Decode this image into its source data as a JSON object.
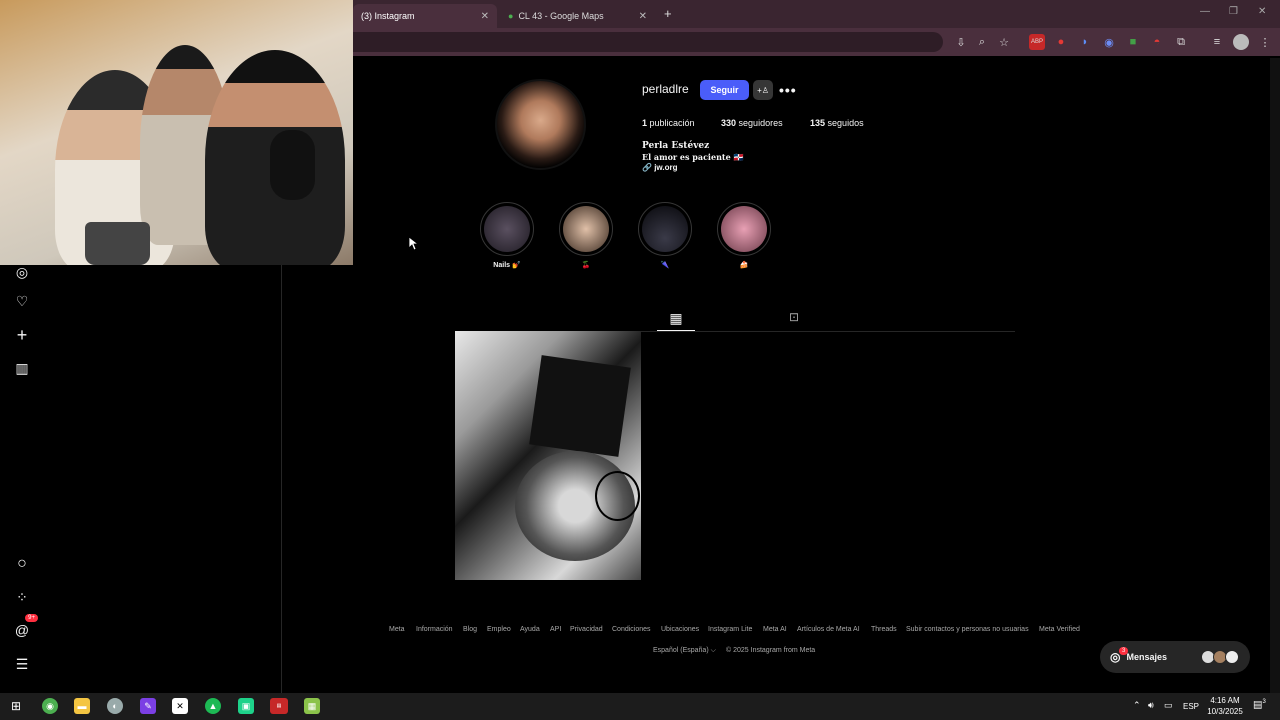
{
  "browser": {
    "tabs": [
      {
        "title": "(3) Instagram",
        "active": true
      },
      {
        "title": "CL 43 - Google Maps",
        "active": false
      }
    ],
    "new_tab_label": "+"
  },
  "profile": {
    "username": "perladlre",
    "follow_label": "Seguir",
    "stats": [
      {
        "count": "1",
        "label": "publicación"
      },
      {
        "count": "330",
        "label": "seguidores"
      },
      {
        "count": "135",
        "label": "seguidos"
      }
    ],
    "full_name": "Perla Estévez",
    "bio": "El amor es paciente 🇩🇴",
    "link": "jw.org"
  },
  "highlights": [
    {
      "label": "Nails 💅",
      "color": "#3a3440"
    },
    {
      "label": "🍒",
      "color": "#c9a48a"
    },
    {
      "label": "🌂",
      "color": "#15161c"
    },
    {
      "label": "🍰",
      "color": "#b06a7c"
    }
  ],
  "footer": {
    "links": [
      "Meta",
      "Información",
      "Blog",
      "Empleo",
      "Ayuda",
      "API",
      "Privacidad",
      "Condiciones",
      "Ubicaciones",
      "Instagram Lite",
      "Meta AI",
      "Artículos de Meta AI",
      "Threads",
      "Subir contactos y personas no usuarias",
      "Meta Verified"
    ],
    "language": "Español (España) ⌵",
    "copyright": "© 2025 Instagram from Meta"
  },
  "messages": {
    "label": "Mensajes",
    "badge": "3"
  },
  "sidebar": {
    "notifications_badge": "9+"
  },
  "taskbar": {
    "language": "ESP",
    "time": "4:16 AM",
    "date": "10/3/2025",
    "notification_count": "3"
  }
}
